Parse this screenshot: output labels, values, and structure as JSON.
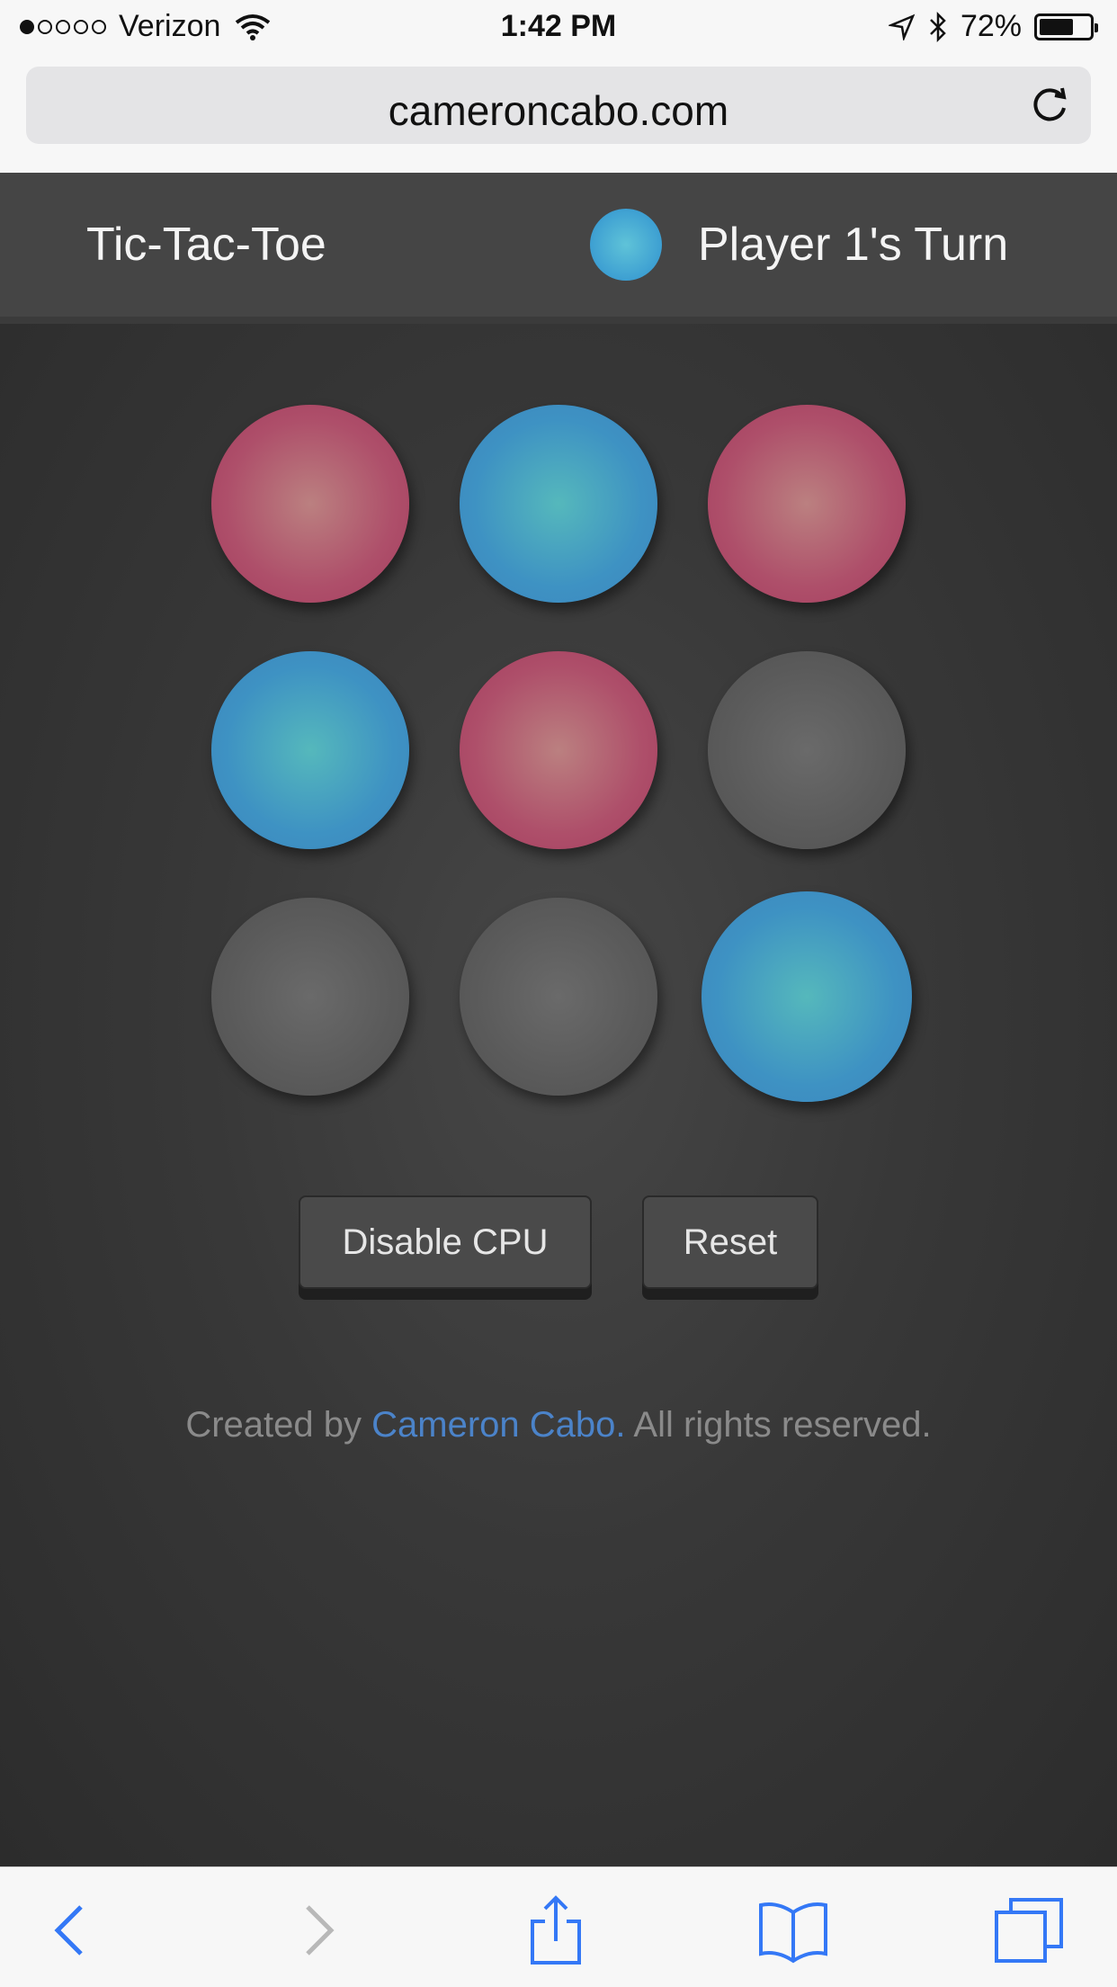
{
  "status_bar": {
    "signal_dots_filled": 1,
    "signal_dots_total": 5,
    "carrier": "Verizon",
    "time": "1:42 PM",
    "battery": "72%",
    "battery_level": 0.72
  },
  "browser": {
    "url": "cameroncabo.com"
  },
  "header": {
    "title": "Tic-Tac-Toe",
    "turn_label": "Player 1's Turn",
    "turn_color": "#3d9fd2"
  },
  "board": {
    "cells": [
      "red",
      "blue",
      "red",
      "blue",
      "red",
      "empty",
      "empty",
      "empty",
      "blue"
    ],
    "highlighted_cell": 8
  },
  "buttons": {
    "disable_cpu": "Disable CPU",
    "reset": "Reset"
  },
  "footer": {
    "prefix": "Created by ",
    "author": "Cameron Cabo.",
    "suffix": " All rights reserved."
  },
  "colors": {
    "player1": "#3d9fd2",
    "player2": "#a43c5e",
    "empty": "#5a5a5a",
    "link": "#4b83c9"
  },
  "toolbar": {
    "icons": [
      "back-icon",
      "forward-icon",
      "share-icon",
      "bookmarks-icon",
      "tabs-icon"
    ]
  }
}
